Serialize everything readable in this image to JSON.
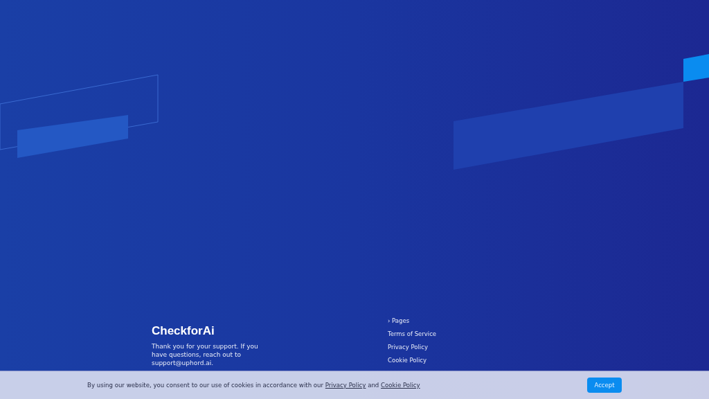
{
  "footer": {
    "brand": "CheckforAi",
    "description": "Thank you for your support. If you have questions, reach out to support@uphord.ai.",
    "links_heading": "› Pages",
    "links": [
      "Terms of Service",
      "Privacy Policy",
      "Cookie Policy"
    ]
  },
  "cookie_banner": {
    "text_before": "By using our website, you consent to our use of cookies in accordance with our",
    "privacy_link": "Privacy Policy",
    "joiner": "and",
    "cookie_link": "Cookie Policy",
    "button": "Accept"
  }
}
